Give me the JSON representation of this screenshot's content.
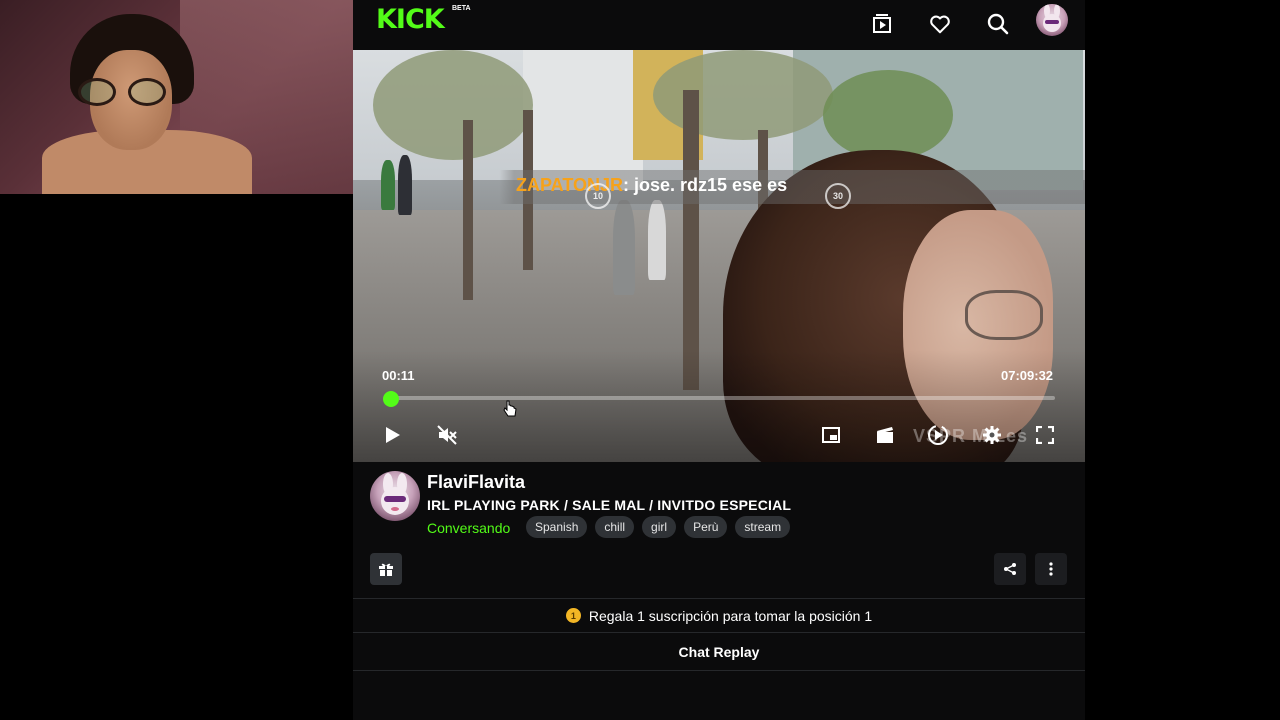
{
  "brand": {
    "logo_text": "KICK",
    "beta_label": "BETA",
    "accent_color": "#53fc18"
  },
  "topbar": {
    "icons": [
      "following-icon",
      "heart-icon",
      "search-icon",
      "user-avatar"
    ]
  },
  "player": {
    "chat_overlay": {
      "username": "ZAPATONJR",
      "message": ": jose. rdz15 ese es"
    },
    "skip_back_label": "10",
    "skip_forward_label": "30",
    "current_time": "00:11",
    "duration": "07:09:32",
    "progress_fraction": 0.0004,
    "watermark": "VSPR M Les"
  },
  "stream": {
    "channel_name": "FlaviFlavita",
    "title": "IRL PLAYING PARK / SALE MAL / INVITDO ESPECIAL",
    "category": "Conversando",
    "tags": [
      "Spanish",
      "chill",
      "girl",
      "Perù",
      "stream"
    ]
  },
  "gift_banner": {
    "coin_label": "1",
    "text": "Regala 1 suscripción para tomar la posición 1"
  },
  "chat": {
    "title": "Chat Replay"
  }
}
